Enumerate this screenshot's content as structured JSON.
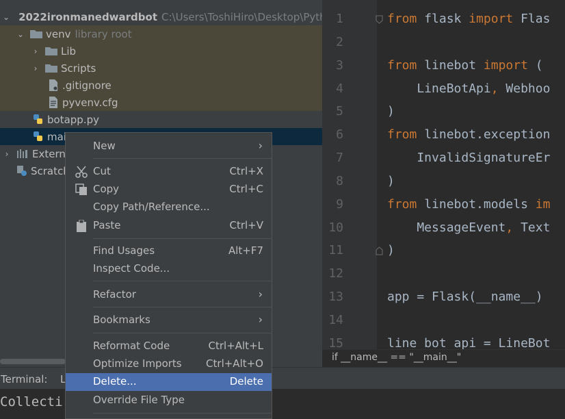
{
  "project_tree": {
    "root": {
      "name": "2022ironmanedwardbot",
      "path": "C:\\Users\\ToshiHiro\\Desktop\\Pytho"
    },
    "venv": {
      "name": "venv",
      "tag": "library root"
    },
    "lib": "Lib",
    "scripts": "Scripts",
    "gitignore": ".gitignore",
    "pyvenv": "pyvenv.cfg",
    "botapp": "botapp.py",
    "main_partial": "mai",
    "external_partial": "Externa",
    "scratch_partial": "Scratch"
  },
  "editor": {
    "line_numbers": [
      "1",
      "2",
      "3",
      "4",
      "5",
      "6",
      "7",
      "8",
      "9",
      "10",
      "11",
      "12",
      "13",
      "14",
      "15"
    ],
    "lines": {
      "l1_kw1": "from",
      "l1_mid": " flask ",
      "l1_kw2": "import",
      "l1_rest": " Flas",
      "l3_kw1": "from",
      "l3_mid": " linebot ",
      "l3_kw2": "import",
      "l3_rest": " (",
      "l4_a": "    LineBotApi",
      "l4_comma": ",",
      "l4_b": " Webhoo",
      "l5": ")",
      "l6_kw": "from",
      "l6_rest": " linebot.exception",
      "l7": "    InvalidSignatureEr",
      "l8": ")",
      "l9_kw": "from",
      "l9_mid": " linebot.models ",
      "l9_kw2": "im",
      "l10_a": "    MessageEvent",
      "l10_comma": ",",
      "l10_b": " Text",
      "l11": ")",
      "l13": "app = Flask(__name__)",
      "l15": "line_bot_api = LineBot"
    },
    "breadcrumb": "if __name__ == \"__main__\""
  },
  "bottom": {
    "terminal_label": "Terminal:",
    "terminal_tab": "L",
    "terminal_text": "Collecti"
  },
  "context_menu": {
    "new": "New",
    "cut": "Cut",
    "cut_sc": "Ctrl+X",
    "copy": "Copy",
    "copy_sc": "Ctrl+C",
    "copy_path": "Copy Path/Reference...",
    "paste": "Paste",
    "paste_sc": "Ctrl+V",
    "find_usages": "Find Usages",
    "find_usages_sc": "Alt+F7",
    "inspect": "Inspect Code...",
    "refactor": "Refactor",
    "bookmarks": "Bookmarks",
    "reformat": "Reformat Code",
    "reformat_sc": "Ctrl+Alt+L",
    "optimize": "Optimize Imports",
    "optimize_sc": "Ctrl+Alt+O",
    "delete": "Delete...",
    "delete_sc": "Delete",
    "override": "Override File Type"
  },
  "colors": {
    "keyword": "#cc7832",
    "highlight": "#4b6eaf",
    "selected_row": "#0d293e"
  }
}
